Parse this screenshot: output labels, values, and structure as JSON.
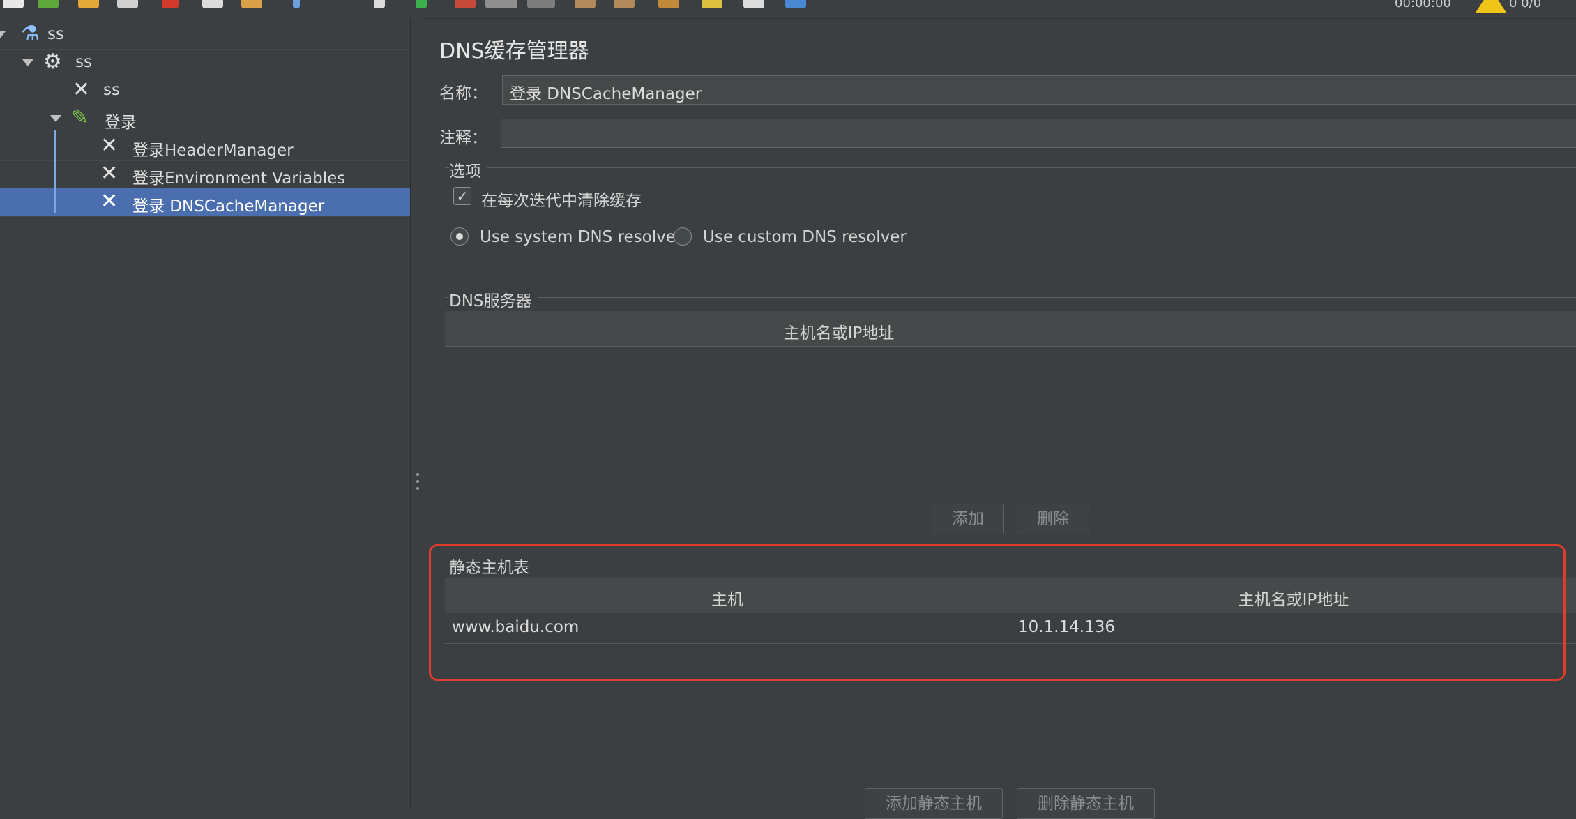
{
  "toolbar": {
    "timer": "00:00:00",
    "counter": "0 0/0"
  },
  "tree": {
    "items": [
      {
        "label": "ss"
      },
      {
        "label": "ss"
      },
      {
        "label": "ss"
      },
      {
        "label": "登录"
      },
      {
        "label": "登录HeaderManager"
      },
      {
        "label": "登录Environment Variables"
      },
      {
        "label": "登录 DNSCacheManager"
      }
    ]
  },
  "panel": {
    "title": "DNS缓存管理器",
    "name_label": "名称：",
    "name_value": "登录 DNSCacheManager",
    "comment_label": "注释：",
    "comment_value": "",
    "options": {
      "title": "选项",
      "clear_cache_label": "在每次迭代中清除缓存",
      "clear_cache_checked": true,
      "system_resolver_label": "Use system DNS resolver",
      "custom_resolver_label": "Use custom DNS resolver",
      "selected_resolver": "system"
    },
    "dns_servers": {
      "title": "DNS服务器",
      "column": "主机名或IP地址",
      "add_button": "添加",
      "delete_button": "删除"
    },
    "static_hosts": {
      "title": "静态主机表",
      "columns": [
        "主机",
        "主机名或IP地址"
      ],
      "rows": [
        {
          "host": "www.baidu.com",
          "address": "10.1.14.136"
        }
      ],
      "add_button": "添加静态主机",
      "delete_button": "删除静态主机"
    }
  },
  "colors": {
    "background": "#3c3f41",
    "selection": "#4b6eaf",
    "highlight": "#e03c2c"
  }
}
